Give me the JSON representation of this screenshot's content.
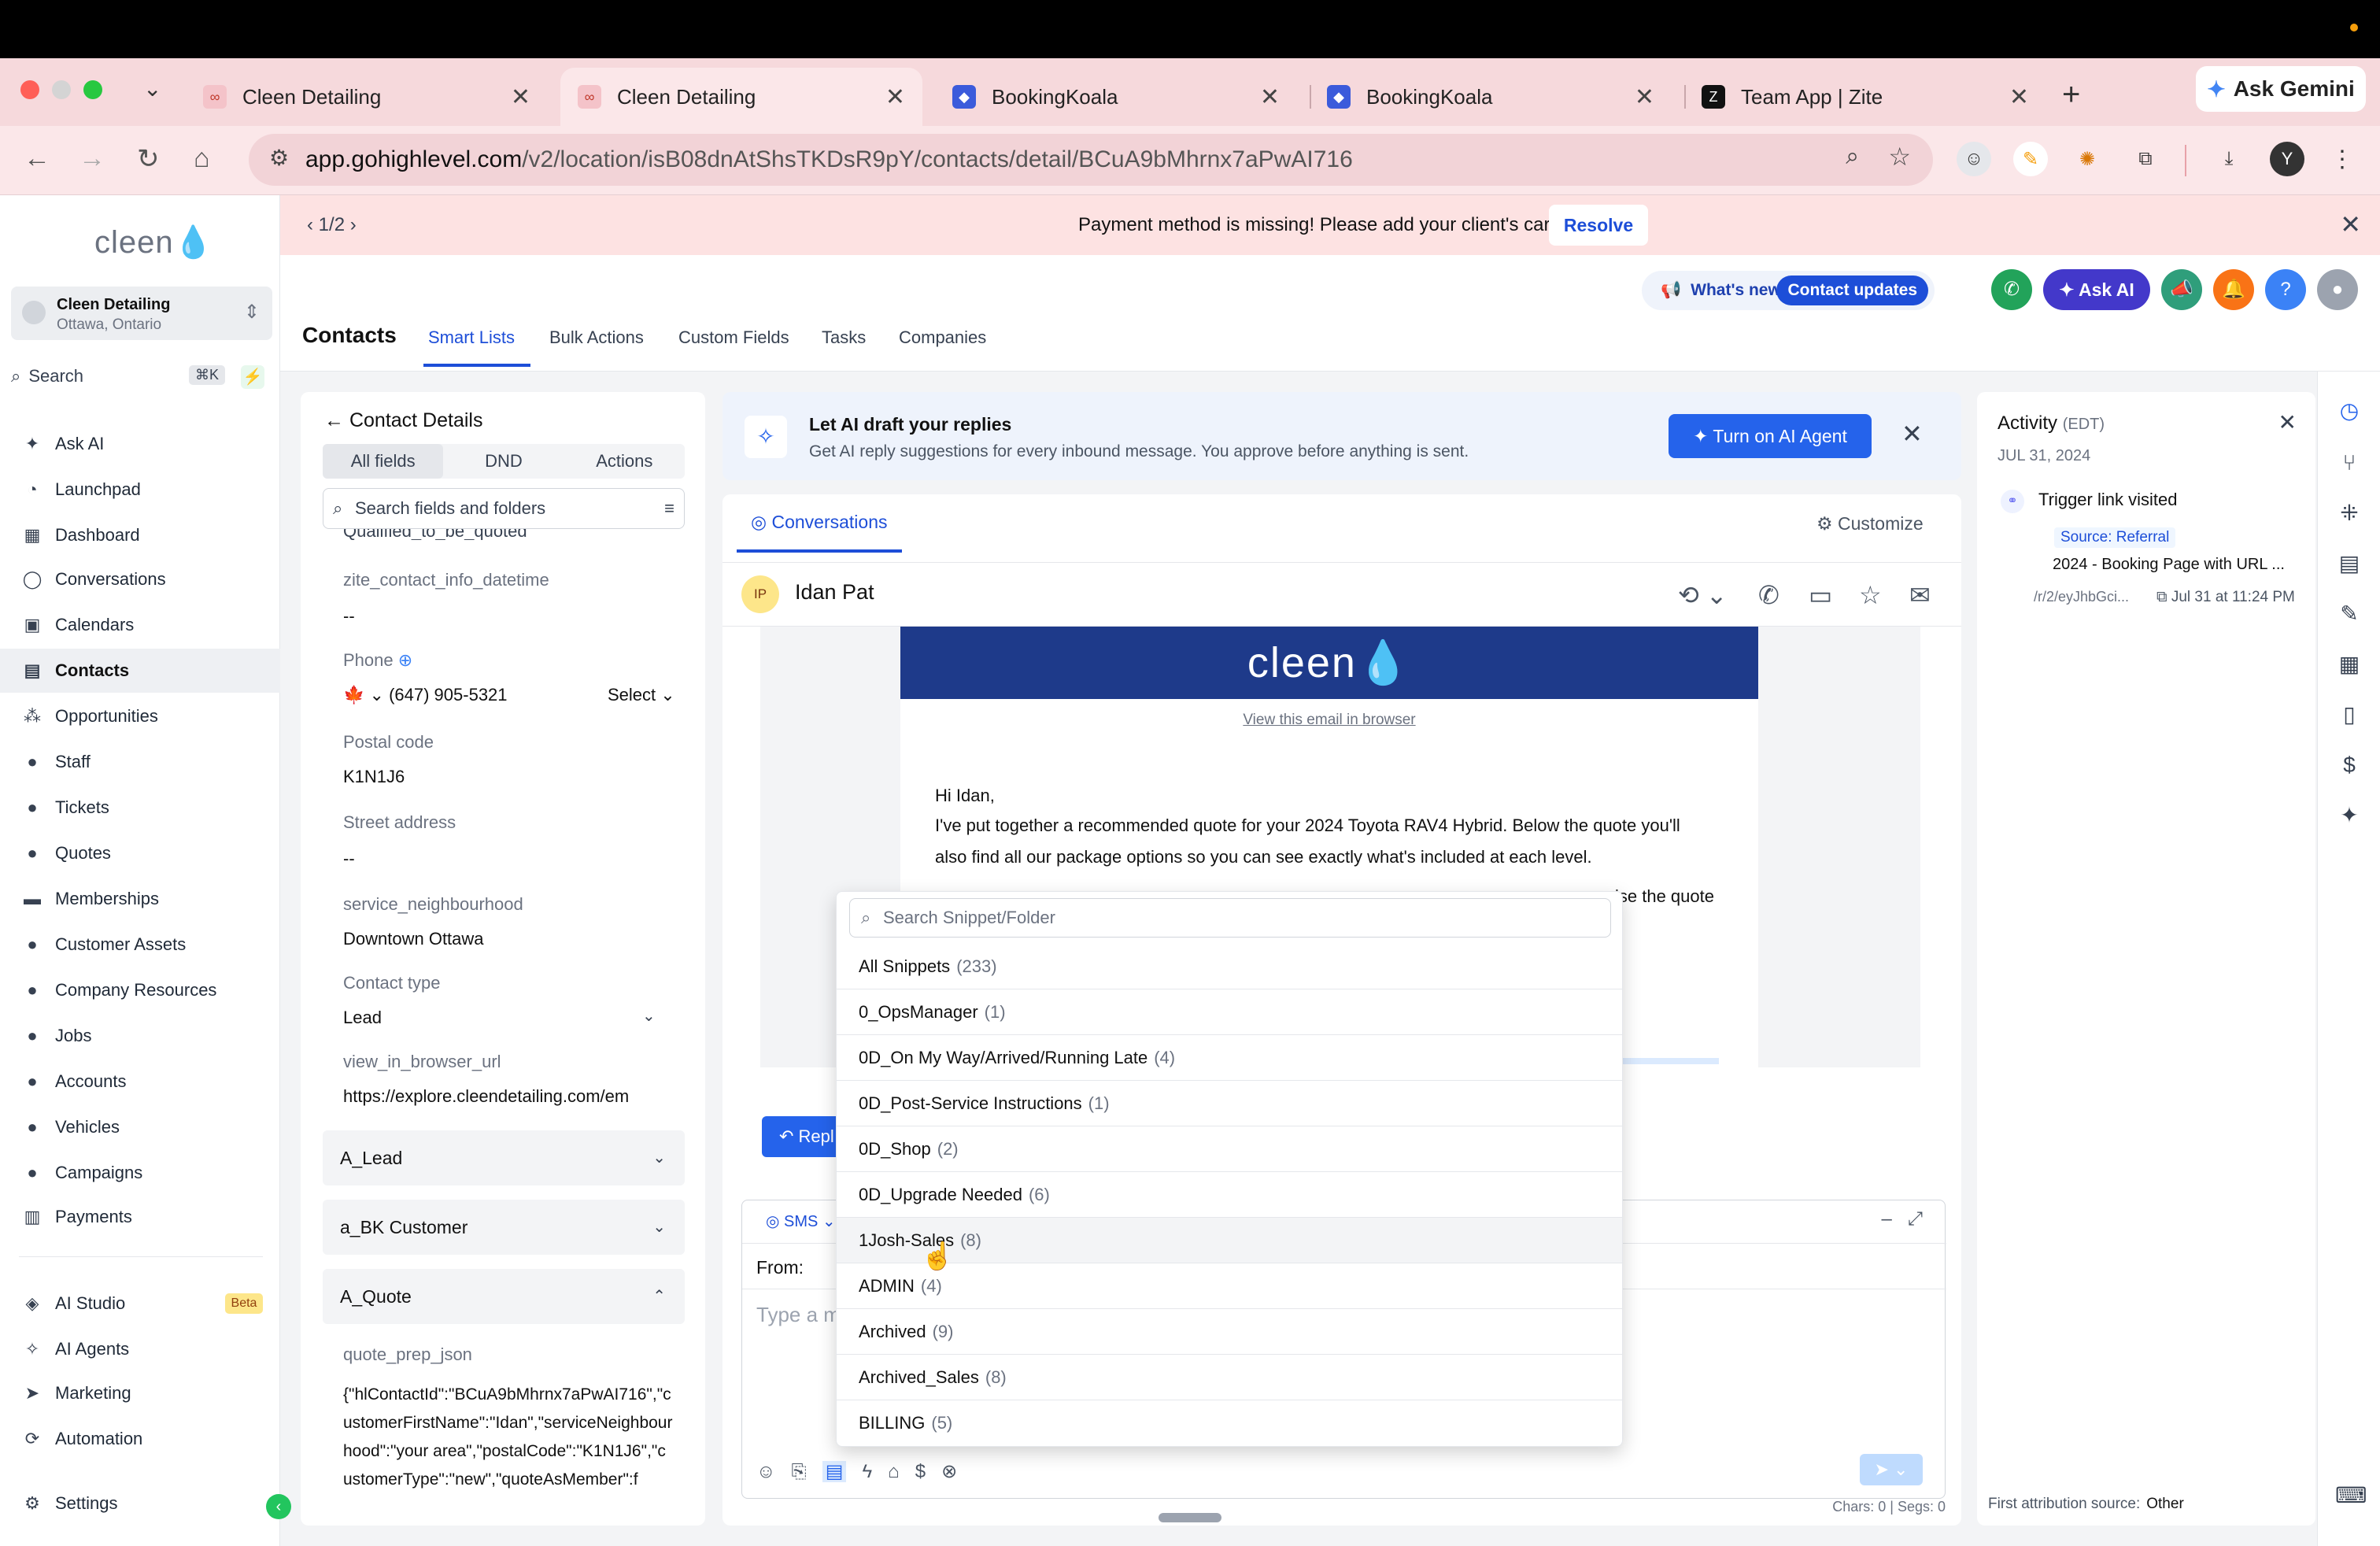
{
  "browser": {
    "tabs": [
      {
        "title": "Cleen Detailing"
      },
      {
        "title": "Cleen Detailing"
      },
      {
        "title": "BookingKoala"
      },
      {
        "title": "BookingKoala"
      },
      {
        "title": "Team App | Zite"
      }
    ],
    "ask_gemini": "Ask Gemini",
    "url_host": "app.gohighlevel.com",
    "url_path": "/v2/location/isB08dnAtShsTKDsR9pY/contacts/detail/BCuA9bMhrnx7aPwAI716",
    "profile_initial": "Y"
  },
  "sidebar": {
    "logo": "cleen",
    "location_name": "Cleen Detailing",
    "location_city": "Ottawa, Ontario",
    "search_label": "Search",
    "search_shortcut": "⌘K",
    "items": [
      {
        "label": "Ask AI",
        "icon": "sparkle-icon"
      },
      {
        "label": "Launchpad",
        "icon": "rocket-icon"
      },
      {
        "label": "Dashboard",
        "icon": "grid-icon"
      },
      {
        "label": "Conversations",
        "icon": "chat-icon"
      },
      {
        "label": "Calendars",
        "icon": "calendar-icon"
      },
      {
        "label": "Contacts",
        "icon": "contacts-icon"
      },
      {
        "label": "Opportunities",
        "icon": "funnel-icon"
      },
      {
        "label": "Staff",
        "icon": "user-icon"
      },
      {
        "label": "Tickets",
        "icon": "ticket-icon"
      },
      {
        "label": "Quotes",
        "icon": "quote-icon"
      },
      {
        "label": "Memberships",
        "icon": "membership-icon"
      },
      {
        "label": "Customer Assets",
        "icon": "asset-icon"
      },
      {
        "label": "Company Resources",
        "icon": "folder-icon"
      },
      {
        "label": "Jobs",
        "icon": "briefcase-icon"
      },
      {
        "label": "Accounts",
        "icon": "account-icon"
      },
      {
        "label": "Vehicles",
        "icon": "car-icon"
      },
      {
        "label": "Campaigns",
        "icon": "megaphone-icon"
      },
      {
        "label": "Payments",
        "icon": "payment-icon"
      }
    ],
    "bottom_items": [
      {
        "label": "AI Studio",
        "badge": "Beta"
      },
      {
        "label": "AI Agents"
      },
      {
        "label": "Marketing"
      },
      {
        "label": "Automation"
      },
      {
        "label": "Settings"
      }
    ]
  },
  "banner": {
    "pager": "1/2",
    "message": "Payment method is missing! Please add your client's card.",
    "resolve": "Resolve"
  },
  "header": {
    "whats_new": "What's new",
    "contact_updates": "Contact updates",
    "ask_ai": "Ask AI",
    "title": "Contacts",
    "tabs": [
      "Smart Lists",
      "Bulk Actions",
      "Custom Fields",
      "Tasks",
      "Companies"
    ]
  },
  "contact": {
    "title": "Contact Details",
    "tabs": [
      "All fields",
      "DND",
      "Actions"
    ],
    "search_placeholder": "Search fields and folders",
    "clipped_field": "Qualified_to_be_quoted",
    "fields": [
      {
        "label": "zite_contact_info_datetime",
        "value": "--"
      },
      {
        "label": "Phone",
        "value": "(647) 905-5321",
        "extra": "Select"
      },
      {
        "label": "Postal code",
        "value": "K1N1J6"
      },
      {
        "label": "Street address",
        "value": "--"
      },
      {
        "label": "service_neighbourhood",
        "value": "Downtown Ottawa"
      },
      {
        "label": "Contact type",
        "value": "Lead"
      },
      {
        "label": "view_in_browser_url",
        "value": "https://explore.cleendetailing.com/em"
      }
    ],
    "sections": [
      "A_Lead",
      "a_BK Customer",
      "A_Quote"
    ],
    "json_label": "quote_prep_json",
    "json_value": "{\"hlContactId\":\"BCuA9bMhrnx7aPwAI716\",\"customerFirstName\":\"Idan\",\"serviceNeighbourhood\":\"your area\",\"postalCode\":\"K1N1J6\",\"customerType\":\"new\",\"quoteAsMember\":f"
  },
  "ai_draft": {
    "title": "Let AI draft your replies",
    "subtitle": "Get AI reply suggestions for every inbound message. You approve before anything is sent.",
    "button": "Turn on AI Agent"
  },
  "conversation": {
    "tab": "Conversations",
    "customize": "Customize",
    "contact_initials": "IP",
    "contact_name": "Idan Pat",
    "email_logo": "cleen",
    "view_in_browser": "View this email in browser",
    "greeting": "Hi Idan,",
    "body_line1": "I've put together a recommended quote for your 2024 Toyota RAV4 Hybrid. Below the quote you'll",
    "body_line2": "also find all our package options so you can see exactly what's included at each level.",
    "body_line3_tail": "ise the quote",
    "reply": "Repl",
    "channel": "SMS",
    "from_label": "From:",
    "message_placeholder": "Type a m",
    "chars": "Chars: 0 | Segs: 0"
  },
  "snippets": {
    "search_placeholder": "Search Snippet/Folder",
    "items": [
      {
        "name": "All Snippets",
        "count": "(233)"
      },
      {
        "name": "0_OpsManager",
        "count": "(1)"
      },
      {
        "name": "0D_On My Way/Arrived/Running Late",
        "count": "(4)"
      },
      {
        "name": "0D_Post-Service Instructions",
        "count": "(1)"
      },
      {
        "name": "0D_Shop",
        "count": "(2)"
      },
      {
        "name": "0D_Upgrade Needed",
        "count": "(6)"
      },
      {
        "name": "1Josh-Sales",
        "count": "(8)"
      },
      {
        "name": "ADMIN",
        "count": "(4)"
      },
      {
        "name": "Archived",
        "count": "(9)"
      },
      {
        "name": "Archived_Sales",
        "count": "(8)"
      },
      {
        "name": "BILLING",
        "count": "(5)"
      }
    ]
  },
  "activity": {
    "title": "Activity",
    "tz": "(EDT)",
    "date": "JUL 31, 2024",
    "event": "Trigger link visited",
    "source": "Source: Referral",
    "page": "2024 - Booking Page with URL ...",
    "url": "/r/2/eyJhbGci...",
    "when": "Jul 31 at 11:24 PM",
    "first_attr_label": "First attribution source:",
    "first_attr_value": "Other"
  }
}
